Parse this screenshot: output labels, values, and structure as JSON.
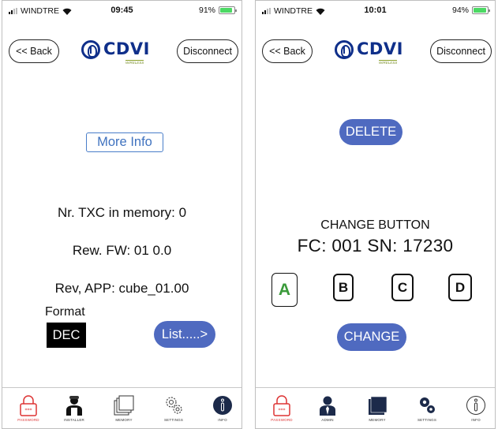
{
  "left": {
    "status": {
      "carrier": "WINDTRE",
      "time": "09:45",
      "battery": "91%",
      "battery_level": 0.91
    },
    "nav": {
      "back": "<< Back",
      "logo": "CDVI",
      "logo_sub": "WIRELESS",
      "disconnect": "Disconnect"
    },
    "more_info": "More Info",
    "lines": [
      "Nr. TXC in memory: 0",
      "Rew. FW: 01 0.0",
      "Rev, APP: cube_01.00"
    ],
    "format_label": "Format",
    "format_value": "DEC",
    "list_button": "List.....>",
    "tabs": [
      "PASSWORD",
      "INSTALLER",
      "MEMORY",
      "SETTINGS",
      "INFO"
    ],
    "active_tab": "INFO"
  },
  "right": {
    "status": {
      "carrier": "WINDTRE",
      "time": "10:01",
      "battery": "94%",
      "battery_level": 0.94
    },
    "nav": {
      "back": "<< Back",
      "logo": "CDVI",
      "logo_sub": "WIRELESS",
      "disconnect": "Disconnect"
    },
    "delete_button": "DELETE",
    "change_title": "CHANGE BUTTON",
    "fc_sn": "FC: 001  SN: 17230",
    "keys": [
      "A",
      "B",
      "C",
      "D"
    ],
    "selected_key": "A",
    "change_button": "CHANGE",
    "tabs": [
      "PASSWORD",
      "ADMIN",
      "MEMORY",
      "SETTINGS",
      "INFO"
    ]
  },
  "colors": {
    "accent": "#4f6ac0",
    "brand": "#0f2f8a",
    "link": "#3f72bf",
    "selected_key": "#3a9a3a",
    "password_tab": "#d33333"
  }
}
